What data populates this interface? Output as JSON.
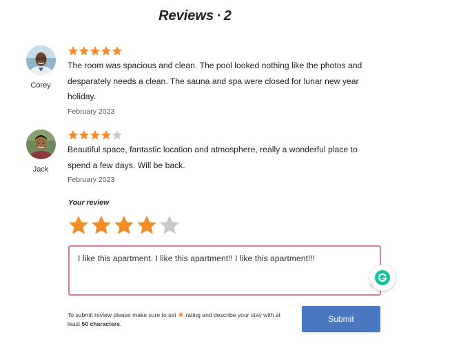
{
  "header": {
    "title": "Reviews",
    "separator": "·",
    "count": "2"
  },
  "reviews": [
    {
      "name": "Corey",
      "rating": 5,
      "comment": "The room was spacious and clean. The pool looked nothing like the photos and desparately needs a clean. The sauna and spa were closed for lunar new year holiday.",
      "date": "February 2023"
    },
    {
      "name": "Jack",
      "rating": 4,
      "comment": "Beautiful space, fantastic location and atmosphere, really a wonderful place to spend a few days. Will be back.",
      "date": "February 2023"
    }
  ],
  "your_review": {
    "label": "Your review",
    "rating": 4,
    "max_rating": 5,
    "text": "I like this apartment. I like this apartment!! I like this apartment!!!"
  },
  "hint": {
    "prefix": "To submit review please make sure to set",
    "middle": "rating and describe your stay with at least",
    "min_chars": "50 characters",
    "suffix": "."
  },
  "submit_label": "Submit",
  "colors": {
    "star_filled": "#f28c28",
    "star_empty": "#c8c8c8",
    "accent": "#4a78c0",
    "textarea_border": "#d97aa0",
    "grammarly": "#15c39a"
  }
}
